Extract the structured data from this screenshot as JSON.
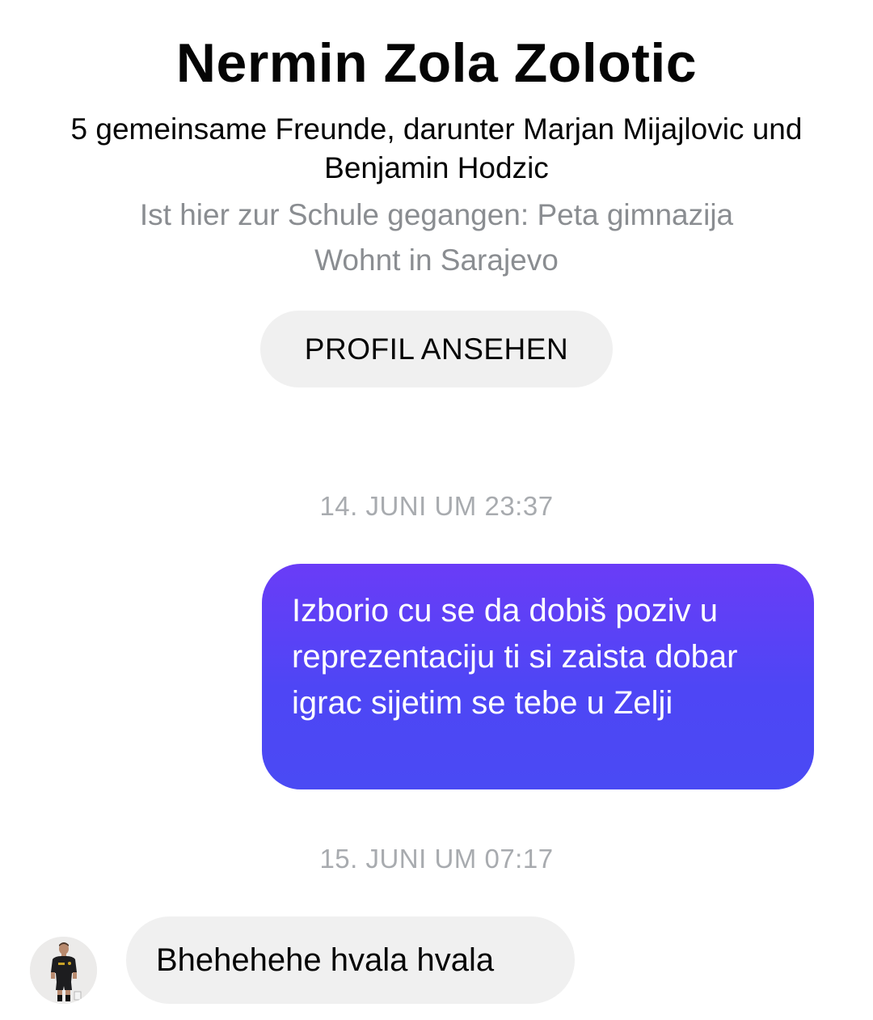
{
  "profile": {
    "name": "Nermin Zola Zolotic",
    "mutual_friends": "5 gemeinsame Freunde, darunter Marjan Mijajlovic und Benjamin Hodzic",
    "school": "Ist hier zur Schule gegangen: Peta gimnazija",
    "hometown": "Wohnt in Sarajevo",
    "view_profile_label": "PROFIL ANSEHEN"
  },
  "conversation": {
    "timestamp_1": "14. JUNI UM 23:37",
    "message_sent": "Izborio cu se da dobiš poziv u reprezentaciju ti si zaista dobar igrac sijetim se tebe u Zelji",
    "timestamp_2": "15. JUNI UM 07:17",
    "message_received": "Bhehehehe hvala hvala"
  },
  "colors": {
    "sent_bubble_top": "#6a3cf7",
    "sent_bubble_bottom": "#4a4af4",
    "received_bubble": "#f0f0f0",
    "secondary_text": "#8a8d91"
  },
  "icons": {
    "avatar": "user-avatar-photo"
  }
}
